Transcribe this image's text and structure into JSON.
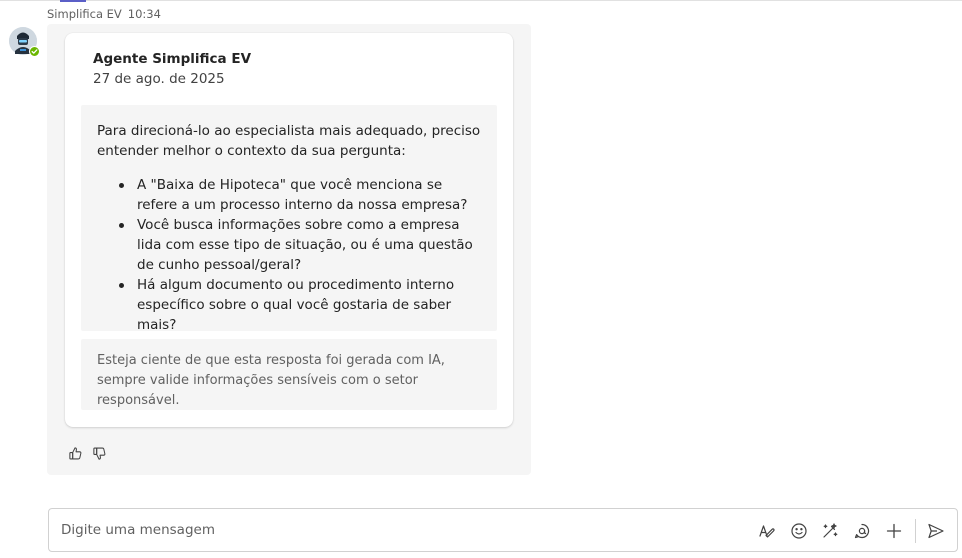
{
  "message": {
    "sender": "Simplifica EV",
    "time": "10:34"
  },
  "card": {
    "title": "Agente Simplifica EV",
    "date": "27 de ago. de 2025",
    "intro": "Para direcioná-lo ao especialista mais adequado, preciso entender melhor o contexto da sua pergunta:",
    "bullets": [
      "A \"Baixa de Hipoteca\" que você menciona se refere a um processo interno da nossa empresa?",
      "Você busca informações sobre como a empresa lida com esse tipo de situação, ou é uma questão de cunho pessoal/geral?",
      "Há algum documento ou procedimento interno específico sobre o qual você gostaria de saber mais?"
    ],
    "disclaimer": "Esteja ciente de que esta resposta foi gerada com IA, sempre valide informações sensíveis com o setor responsável."
  },
  "reactions": {
    "like_icon": "thumbs-up-icon",
    "dislike_icon": "thumbs-down-icon"
  },
  "compose": {
    "placeholder": "Digite uma mensagem",
    "value": "",
    "tools": [
      "format-icon",
      "emoji-icon",
      "copilot-icon",
      "loop-icon",
      "add-icon",
      "send-icon"
    ]
  },
  "colors": {
    "accent": "#5b5fc7",
    "presence": "#6bb700",
    "bubble": "#f5f5f5"
  }
}
